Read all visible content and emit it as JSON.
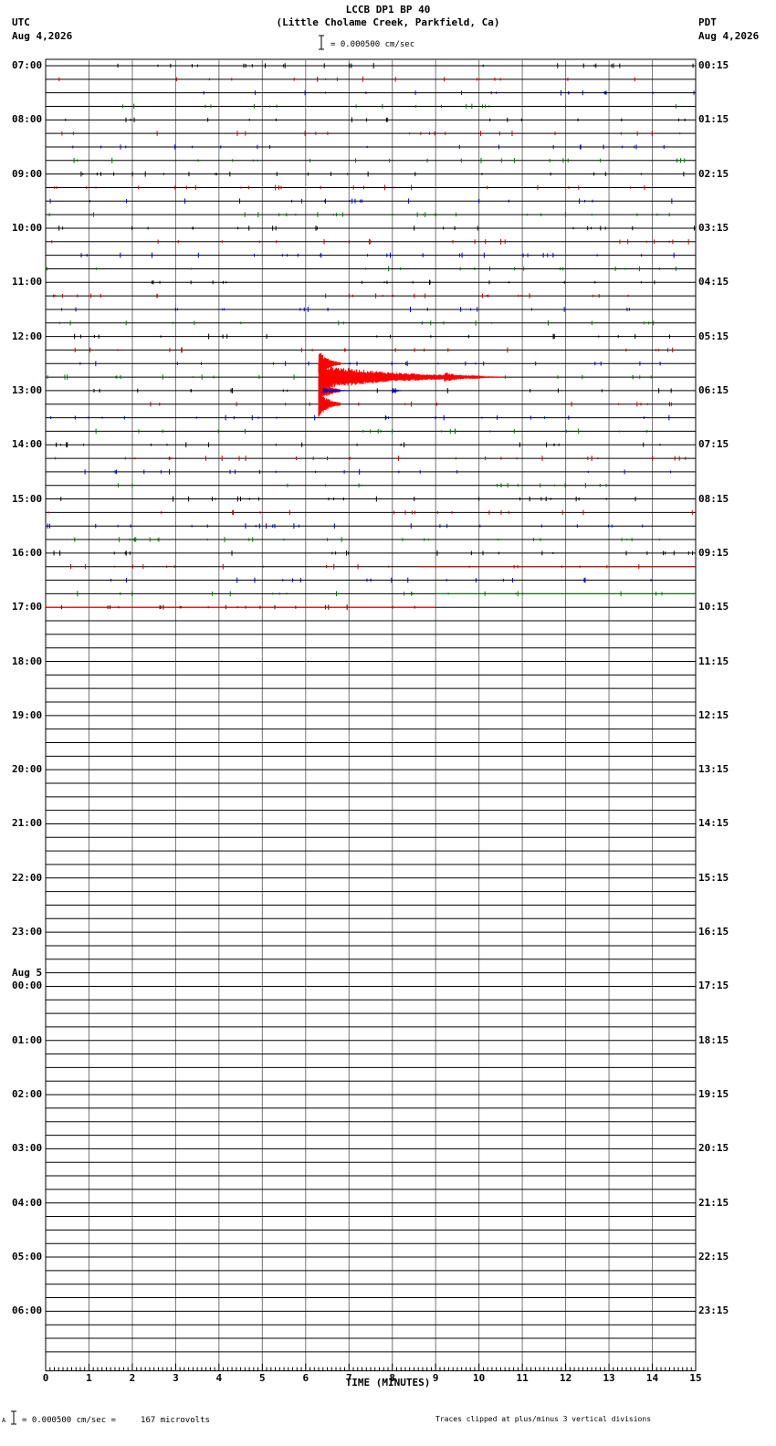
{
  "header": {
    "title": "LCCB DP1 BP 40",
    "subtitle": "(Little Cholame Creek, Parkfield, Ca)",
    "scale_label": "= 0.000500 cm/sec",
    "left_tz": "UTC",
    "left_date": "Aug 4,2026",
    "right_tz": "PDT",
    "right_date": "Aug 4,2026"
  },
  "footer": {
    "scale_note": "= 0.000500 cm/sec =     167 microvolts",
    "clip_note": "Traces clipped at plus/minus 3 vertical divisions",
    "corner_mark": "A"
  },
  "chart_data": {
    "type": "line",
    "xlabel": "TIME (MINUTES)",
    "xlim": [
      0,
      15
    ],
    "x_ticks": [
      "0",
      "1",
      "2",
      "3",
      "4",
      "5",
      "6",
      "7",
      "8",
      "9",
      "10",
      "11",
      "12",
      "13",
      "14",
      "15"
    ],
    "rows_per_hour": 4,
    "row_count": 96,
    "left_hour_labels": [
      "07:00",
      "08:00",
      "09:00",
      "10:00",
      "11:00",
      "12:00",
      "13:00",
      "14:00",
      "15:00",
      "16:00",
      "17:00",
      "18:00",
      "19:00",
      "20:00",
      "21:00",
      "22:00",
      "23:00",
      "00:00",
      "01:00",
      "02:00",
      "03:00",
      "04:00",
      "05:00",
      "06:00"
    ],
    "date_change_label": "Aug 5",
    "date_change_index": 17,
    "right_hour_labels": [
      "00:15",
      "01:15",
      "02:15",
      "03:15",
      "04:15",
      "05:15",
      "06:15",
      "07:15",
      "08:15",
      "09:15",
      "10:15",
      "11:15",
      "12:15",
      "13:15",
      "14:15",
      "15:15",
      "16:15",
      "17:15",
      "18:15",
      "19:15",
      "20:15",
      "21:15",
      "22:15",
      "23:15"
    ],
    "trace_colors": [
      "#000000",
      "#cc0000",
      "#0000cc",
      "#007700"
    ],
    "data_end": {
      "row": 40,
      "minute": 9.0
    },
    "events": [
      {
        "row": 22,
        "start": 6.3,
        "end": 6.8,
        "amplitude": 3.0,
        "color": "#ff0000",
        "clipped": true
      },
      {
        "row": 23,
        "start": 6.3,
        "end": 10.0,
        "amplitude": 3.0,
        "color": "#ff0000",
        "clipped": true
      },
      {
        "row": 23,
        "start": 9.2,
        "end": 10.5,
        "amplitude": 1.2,
        "color": "#ff0000",
        "clipped": false
      },
      {
        "row": 24,
        "start": 6.3,
        "end": 6.8,
        "amplitude": 3.0,
        "color": "#ff0000",
        "clipped": true
      },
      {
        "row": 24,
        "start": 6.4,
        "end": 7.0,
        "amplitude": 0.6,
        "color": "#0000cc",
        "clipped": false
      },
      {
        "row": 24,
        "start": 8.0,
        "end": 8.2,
        "amplitude": 0.7,
        "color": "#0000cc",
        "clipped": false
      },
      {
        "row": 25,
        "start": 6.3,
        "end": 6.8,
        "amplitude": 3.0,
        "color": "#ff0000",
        "clipped": true
      }
    ],
    "flat_segments": [
      {
        "row": 37,
        "start": 8.6,
        "end": 15.0,
        "color": "#cc0000"
      },
      {
        "row": 39,
        "start": 9.0,
        "end": 15.0,
        "color": "#007700"
      },
      {
        "row": 40,
        "start": 0.0,
        "end": 9.0,
        "color": "#ff0000"
      }
    ]
  }
}
